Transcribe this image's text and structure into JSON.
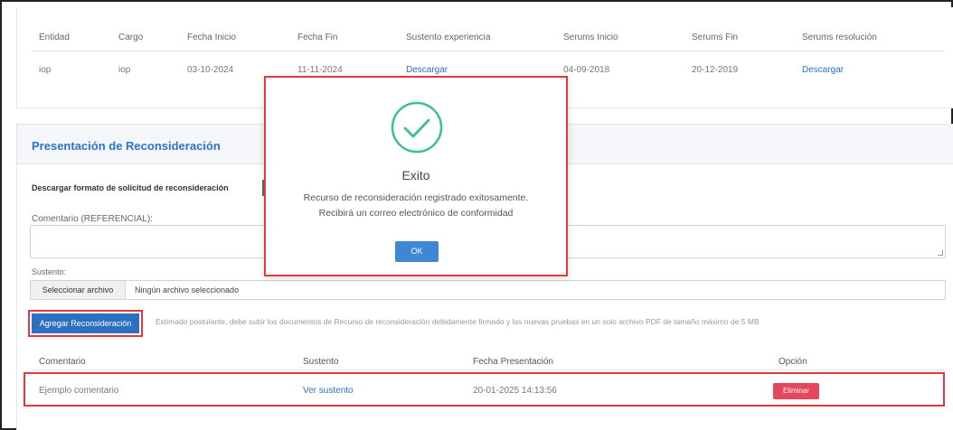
{
  "experience_table": {
    "headers": [
      "Entidad",
      "Cargo",
      "Fecha Inicio",
      "Fecha Fin",
      "Sustento experiencia",
      "Serums Inicio",
      "Serums Fin",
      "Serums resolución"
    ],
    "row": [
      "iop",
      "iop",
      "03-10-2024",
      "11-11-2024",
      "Descargar",
      "04-09-2018",
      "20-12-2019",
      "Descargar"
    ]
  },
  "reconsideration": {
    "title": "Presentación de Reconsideración",
    "download_label": "Descargar formato de solicitud de reconsideración",
    "comment_label": "Comentario (REFERENCIAL):",
    "comment_value": "",
    "support_label": "Sustento:",
    "file_button": "Seleccionar archivo",
    "file_status": "Ningún archivo seleccionado",
    "add_button": "Agregar Reconsideración",
    "hint": "Estimado postulante, debe subir los documentos de Recurso de reconsideración debidamente firmado y las nuevas pruebas en un solo archivo PDF de tamaño máximo de 5 MB",
    "table_headers": [
      "Comentario",
      "Sustento",
      "Fecha Presentación",
      "Opción"
    ],
    "row": {
      "comment": "Ejemplo comentario",
      "support": "Ver sustento",
      "date": "20-01-2025 14:13:56",
      "delete": "Eliminar"
    }
  },
  "modal": {
    "icon": "check-circle-icon",
    "title": "Exito",
    "message_line1": "Recurso de reconsideración registrado exitosamente.",
    "message_line2": "Recibirá un correo electrónico de conformidad",
    "ok": "OK"
  },
  "colors": {
    "primary": "#2d6fc1",
    "success": "#3cc38a",
    "danger": "#e5475c",
    "highlight": "#e0393e"
  }
}
